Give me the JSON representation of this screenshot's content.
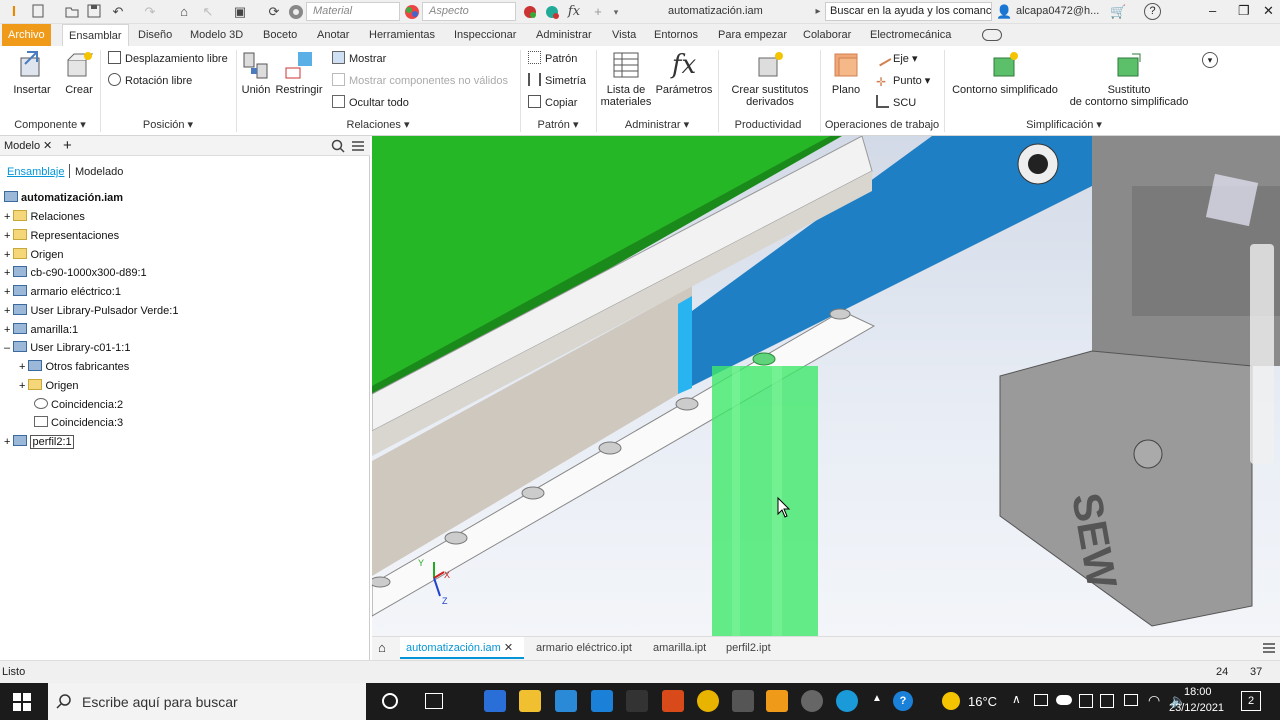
{
  "qat": {
    "material_placeholder": "Material",
    "appearance_placeholder": "Aspecto",
    "fx_label": "fx",
    "doc_title": "automatización.iam",
    "help_search": "Buscar en la ayuda y los comanc",
    "user": "alcapa0472@h...",
    "help_icon": "?",
    "win_min": "–",
    "win_max": "❐",
    "win_close": "✕"
  },
  "tabs": [
    "Archivo",
    "Ensamblar",
    "Diseño",
    "Modelo 3D",
    "Boceto",
    "Anotar",
    "Herramientas",
    "Inspeccionar",
    "Administrar",
    "Vista",
    "Entornos",
    "Para empezar",
    "Colaborar",
    "Electromecánica"
  ],
  "ribbon": {
    "insertar": "Insertar",
    "crear": "Crear",
    "componente": "Componente",
    "desplazamiento": "Desplazamiento libre",
    "rotacion": "Rotación libre",
    "posicion": "Posición",
    "union": "Unión",
    "restringir": "Restringir",
    "mostrar": "Mostrar",
    "mostrar_no_validos": "Mostrar componentes no válidos",
    "ocultar_todo": "Ocultar todo",
    "relaciones": "Relaciones",
    "patron_btn": "Patrón",
    "simetria": "Simetría",
    "copiar": "Copiar",
    "patron_grp": "Patrón",
    "lista_1": "Lista de",
    "lista_2": "materiales",
    "parametros": "Parámetros",
    "fx": "fx",
    "administrar": "Administrar",
    "crear_sust_1": "Crear sustitutos",
    "crear_sust_2": "derivados",
    "productividad": "Productividad",
    "plano": "Plano",
    "eje": "Eje",
    "punto": "Punto",
    "scu": "SCU",
    "operaciones": "Operaciones de trabajo",
    "contorno": "Contorno simplificado",
    "sustituto_1": "Sustituto",
    "sustituto_2": "de contorno simplificado",
    "simplificacion": "Simplificación"
  },
  "browser": {
    "title": "Modelo",
    "close": "✕",
    "add": "+",
    "subtab_active": "Ensamblaje",
    "subtab_other": "Modelado",
    "root": "automatización.iam",
    "items": [
      {
        "label": "Relaciones"
      },
      {
        "label": "Representaciones"
      },
      {
        "label": "Origen"
      },
      {
        "label": "cb-c90-1000x300-d89:1"
      },
      {
        "label": "armario eléctrico:1"
      },
      {
        "label": "User Library-Pulsador Verde:1"
      },
      {
        "label": "amarilla:1"
      },
      {
        "label": "User Library-c01-1:1"
      },
      {
        "label": "Otros fabricantes"
      },
      {
        "label": "Origen"
      },
      {
        "label": "Coincidencia:2"
      },
      {
        "label": "Coincidencia:3"
      },
      {
        "label": "perfil2:1"
      }
    ]
  },
  "viewport": {
    "axis_x": "X",
    "axis_y": "Y",
    "axis_z": "Z",
    "motor_brand": "SEW"
  },
  "doctabs": {
    "active": "automatización.iam",
    "close": "✕",
    "others": [
      "armario eléctrico.ipt",
      "amarilla.ipt",
      "perfil2.ipt"
    ]
  },
  "status": {
    "text": "Listo",
    "num1": "24",
    "num2": "37"
  },
  "taskbar": {
    "search": "Escribe aquí para buscar",
    "weather": "16°C",
    "time": "18:00",
    "date": "23/12/2021",
    "notif": "2"
  },
  "colors": {
    "accent_file": "#f09a1a",
    "selection": "#0696d7",
    "green": "#22bb22"
  }
}
